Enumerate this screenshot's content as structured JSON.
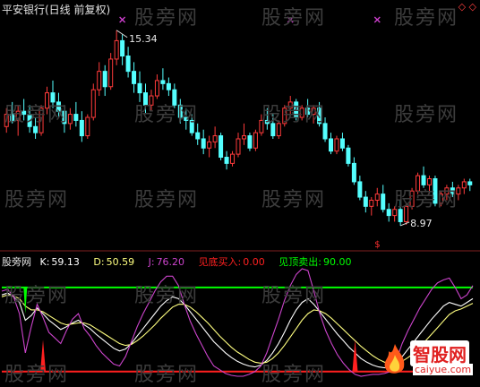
{
  "title": "平安银行(日线 前复权)",
  "watermark": "股旁网",
  "annotations": {
    "high": "15.34",
    "low": "8.97"
  },
  "indicator": {
    "name": "股旁网",
    "k_label": "K:",
    "k_value": "59.13",
    "d_label": "D:",
    "d_value": "50.59",
    "j_label": "J:",
    "j_value": "76.20",
    "buy_label": "见底买入:",
    "buy_value": "0.00",
    "sell_label": "见顶卖出:",
    "sell_value": "90.00"
  },
  "logo": {
    "name": "智股网",
    "url": "caiyue.com",
    "flame_icon": "flame-icon"
  },
  "colors": {
    "up": "#ff3b3b",
    "down": "#54ffff",
    "k": "#ffffff",
    "d": "#ffff80",
    "j": "#cc44cc",
    "buy": "#ff2020",
    "sell": "#00ff00"
  },
  "chart_data": [
    {
      "type": "candlestick",
      "title": "平安银行(日线 前复权)",
      "candles": [
        [
          12.2,
          12.8,
          12.0,
          12.6
        ],
        [
          12.6,
          13.0,
          12.3,
          12.4
        ],
        [
          12.4,
          12.9,
          11.9,
          12.7
        ],
        [
          12.7,
          13.1,
          12.4,
          12.6
        ],
        [
          12.6,
          12.9,
          12.0,
          12.2
        ],
        [
          12.2,
          12.5,
          11.8,
          12.0
        ],
        [
          12.0,
          12.9,
          11.9,
          12.8
        ],
        [
          12.8,
          13.5,
          12.6,
          13.3
        ],
        [
          13.3,
          13.7,
          12.8,
          13.0
        ],
        [
          13.0,
          13.3,
          12.5,
          12.7
        ],
        [
          12.7,
          12.9,
          12.0,
          12.3
        ],
        [
          12.3,
          12.8,
          12.1,
          12.6
        ],
        [
          12.6,
          13.0,
          12.2,
          12.4
        ],
        [
          12.4,
          12.7,
          11.7,
          11.9
        ],
        [
          11.9,
          12.6,
          11.8,
          12.5
        ],
        [
          12.5,
          13.6,
          12.4,
          13.4
        ],
        [
          13.4,
          14.3,
          13.2,
          14.0
        ],
        [
          14.0,
          14.2,
          13.2,
          13.5
        ],
        [
          13.5,
          14.6,
          13.4,
          14.4
        ],
        [
          14.4,
          15.34,
          14.2,
          15.0
        ],
        [
          15.0,
          15.2,
          14.2,
          14.5
        ],
        [
          14.5,
          14.8,
          13.8,
          14.0
        ],
        [
          14.0,
          14.3,
          13.3,
          13.6
        ],
        [
          13.6,
          14.0,
          13.0,
          13.3
        ],
        [
          13.3,
          13.6,
          12.6,
          12.9
        ],
        [
          12.9,
          13.4,
          12.7,
          13.2
        ],
        [
          13.2,
          13.9,
          13.1,
          13.7
        ],
        [
          13.7,
          14.1,
          13.4,
          13.6
        ],
        [
          13.6,
          13.8,
          13.2,
          13.4
        ],
        [
          13.4,
          13.6,
          12.8,
          12.9
        ],
        [
          12.9,
          13.1,
          12.3,
          12.5
        ],
        [
          12.5,
          12.8,
          12.1,
          12.4
        ],
        [
          12.4,
          12.6,
          11.9,
          12.0
        ],
        [
          12.0,
          12.3,
          11.6,
          11.8
        ],
        [
          11.8,
          12.1,
          11.3,
          11.5
        ],
        [
          11.5,
          11.9,
          11.2,
          11.7
        ],
        [
          11.7,
          12.2,
          11.5,
          11.9
        ],
        [
          11.9,
          12.0,
          11.1,
          11.2
        ],
        [
          11.2,
          11.4,
          10.8,
          11.0
        ],
        [
          11.0,
          11.4,
          10.9,
          11.3
        ],
        [
          11.3,
          12.0,
          11.2,
          11.8
        ],
        [
          11.8,
          12.3,
          11.6,
          11.9
        ],
        [
          11.9,
          12.0,
          11.4,
          11.5
        ],
        [
          11.5,
          12.1,
          11.4,
          12.0
        ],
        [
          12.0,
          12.6,
          11.9,
          12.4
        ],
        [
          12.4,
          12.8,
          12.1,
          12.3
        ],
        [
          12.3,
          12.6,
          11.8,
          11.9
        ],
        [
          11.9,
          12.4,
          11.8,
          12.3
        ],
        [
          12.3,
          12.9,
          12.2,
          12.8
        ],
        [
          12.8,
          13.2,
          12.6,
          13.0
        ],
        [
          13.0,
          13.1,
          12.4,
          12.5
        ],
        [
          12.5,
          12.9,
          12.4,
          12.8
        ],
        [
          12.8,
          13.1,
          12.5,
          12.6
        ],
        [
          12.6,
          12.9,
          12.3,
          12.8
        ],
        [
          12.8,
          13.0,
          12.2,
          12.3
        ],
        [
          12.3,
          12.5,
          11.7,
          11.8
        ],
        [
          11.8,
          12.0,
          11.3,
          11.4
        ],
        [
          11.4,
          11.9,
          11.3,
          11.8
        ],
        [
          11.8,
          12.0,
          11.4,
          11.5
        ],
        [
          11.5,
          11.6,
          10.9,
          11.0
        ],
        [
          11.0,
          11.2,
          10.3,
          10.4
        ],
        [
          10.4,
          10.6,
          9.8,
          9.9
        ],
        [
          9.9,
          10.1,
          9.4,
          9.6
        ],
        [
          9.6,
          9.9,
          9.3,
          9.8
        ],
        [
          9.8,
          10.2,
          9.6,
          10.0
        ],
        [
          10.0,
          10.3,
          9.4,
          9.5
        ],
        [
          9.5,
          9.7,
          9.1,
          9.3
        ],
        [
          9.3,
          9.6,
          9.1,
          9.5
        ],
        [
          9.5,
          9.8,
          8.97,
          9.1
        ],
        [
          9.1,
          9.7,
          9.0,
          9.6
        ],
        [
          9.6,
          10.2,
          9.5,
          10.1
        ],
        [
          10.1,
          10.7,
          10.0,
          10.6
        ],
        [
          10.6,
          10.9,
          10.2,
          10.3
        ],
        [
          10.3,
          10.6,
          10.0,
          10.5
        ],
        [
          10.5,
          10.6,
          9.6,
          9.7
        ],
        [
          9.7,
          10.1,
          9.6,
          10.0
        ],
        [
          10.0,
          10.3,
          9.8,
          10.2
        ],
        [
          10.2,
          10.4,
          9.9,
          10.0
        ],
        [
          10.0,
          10.3,
          9.8,
          10.2
        ],
        [
          10.2,
          10.5,
          10.0,
          10.4
        ],
        [
          10.4,
          10.5,
          10.1,
          10.3
        ]
      ],
      "ylim": [
        8.5,
        15.8
      ],
      "sell_markers": [
        20,
        49,
        64
      ],
      "buy_markers": [
        64
      ]
    },
    {
      "type": "line",
      "name": "股旁网",
      "ylim": [
        -5,
        110
      ],
      "series": [
        {
          "name": "K",
          "values": [
            82,
            84,
            80,
            74,
            55,
            60,
            68,
            62,
            55,
            50,
            45,
            48,
            52,
            55,
            50,
            46,
            40,
            35,
            30,
            25,
            22,
            24,
            30,
            38,
            46,
            54,
            62,
            70,
            76,
            80,
            78,
            72,
            64,
            56,
            48,
            40,
            32,
            26,
            20,
            15,
            11,
            8,
            6,
            5,
            7,
            12,
            20,
            30,
            42,
            55,
            66,
            74,
            78,
            72,
            64,
            56,
            48,
            40,
            33,
            26,
            20,
            14,
            10,
            7,
            5,
            4,
            6,
            10,
            16,
            24,
            32,
            40,
            48,
            56,
            63,
            70,
            74,
            72,
            70,
            74,
            78
          ]
        },
        {
          "name": "D",
          "values": [
            80,
            82,
            81,
            78,
            70,
            66,
            66,
            64,
            60,
            56,
            52,
            50,
            51,
            52,
            52,
            50,
            46,
            42,
            38,
            34,
            30,
            28,
            29,
            33,
            38,
            44,
            50,
            57,
            63,
            69,
            72,
            72,
            69,
            64,
            58,
            52,
            45,
            38,
            32,
            26,
            21,
            17,
            13,
            10,
            9,
            10,
            14,
            20,
            28,
            37,
            46,
            55,
            62,
            66,
            65,
            62,
            57,
            51,
            45,
            39,
            33,
            27,
            22,
            17,
            13,
            10,
            9,
            9,
            11,
            15,
            20,
            26,
            33,
            40,
            47,
            54,
            61,
            65,
            67,
            70,
            73
          ]
        },
        {
          "name": "J",
          "values": [
            86,
            88,
            80,
            62,
            20,
            48,
            72,
            58,
            42,
            36,
            30,
            44,
            56,
            62,
            46,
            38,
            28,
            20,
            14,
            8,
            6,
            16,
            32,
            48,
            62,
            74,
            86,
            96,
            102,
            102,
            92,
            72,
            54,
            40,
            28,
            16,
            6,
            2,
            -2,
            -4,
            -5,
            -5,
            -3,
            0,
            6,
            20,
            38,
            56,
            76,
            92,
            104,
            110,
            108,
            86,
            62,
            44,
            30,
            18,
            9,
            2,
            -3,
            -5,
            -4,
            -3,
            -3,
            -2,
            0,
            12,
            30,
            44,
            56,
            68,
            78,
            88,
            95,
            98,
            100,
            90,
            78,
            82,
            92
          ]
        }
      ],
      "buy_line": 0,
      "sell_line": 90,
      "buy_signals": [
        7,
        60
      ]
    }
  ]
}
